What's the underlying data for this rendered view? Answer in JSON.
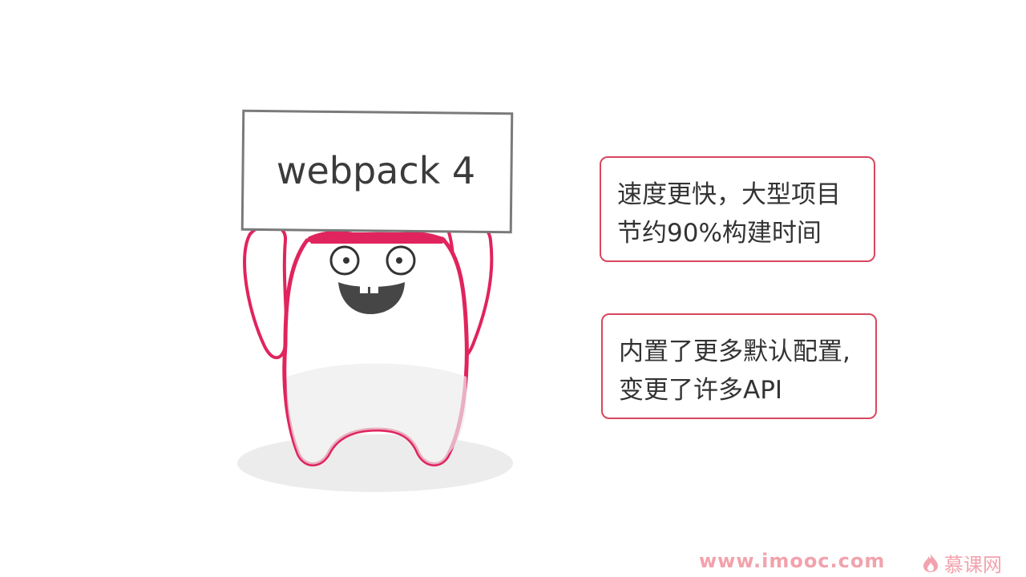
{
  "slide": {
    "sign_text": "webpack 4",
    "info_boxes": [
      {
        "lines": [
          "速度更快，大型项目",
          "节约90%构建时间"
        ]
      },
      {
        "lines": [
          "内置了更多默认配置,",
          "变更了许多API"
        ]
      }
    ]
  },
  "watermark": {
    "url": "www.imooc.com",
    "brand": "慕课网",
    "logo_icon": "flame-logo-icon"
  },
  "colors": {
    "accent": "#d8475f",
    "mascot_outline": "#e0245e",
    "watermark": "#f2a2ac",
    "text": "#333333"
  }
}
